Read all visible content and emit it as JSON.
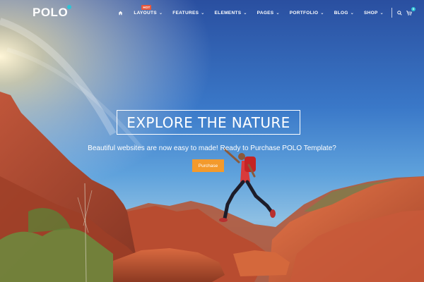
{
  "header": {
    "logo_text": "POLO",
    "nav": [
      {
        "label": "LAYOUTS",
        "badge": "HOT"
      },
      {
        "label": "FEATURES"
      },
      {
        "label": "ELEMENTS"
      },
      {
        "label": "PAGES"
      },
      {
        "label": "PORTFOLIO"
      },
      {
        "label": "BLOG"
      },
      {
        "label": "SHOP"
      }
    ],
    "cart_count": "0"
  },
  "hero": {
    "title": "EXPLORE THE NATURE",
    "subtitle": "Beautiful websites are now easy to made! Ready to Purchase POLO Template?",
    "button_label": "Purchase"
  },
  "colors": {
    "accent": "#f39a2c",
    "badge": "#e8573b",
    "logo_dot": "#2ec4d6"
  },
  "icons": [
    "home-icon",
    "chevron-down-icon",
    "search-icon",
    "cart-icon"
  ]
}
